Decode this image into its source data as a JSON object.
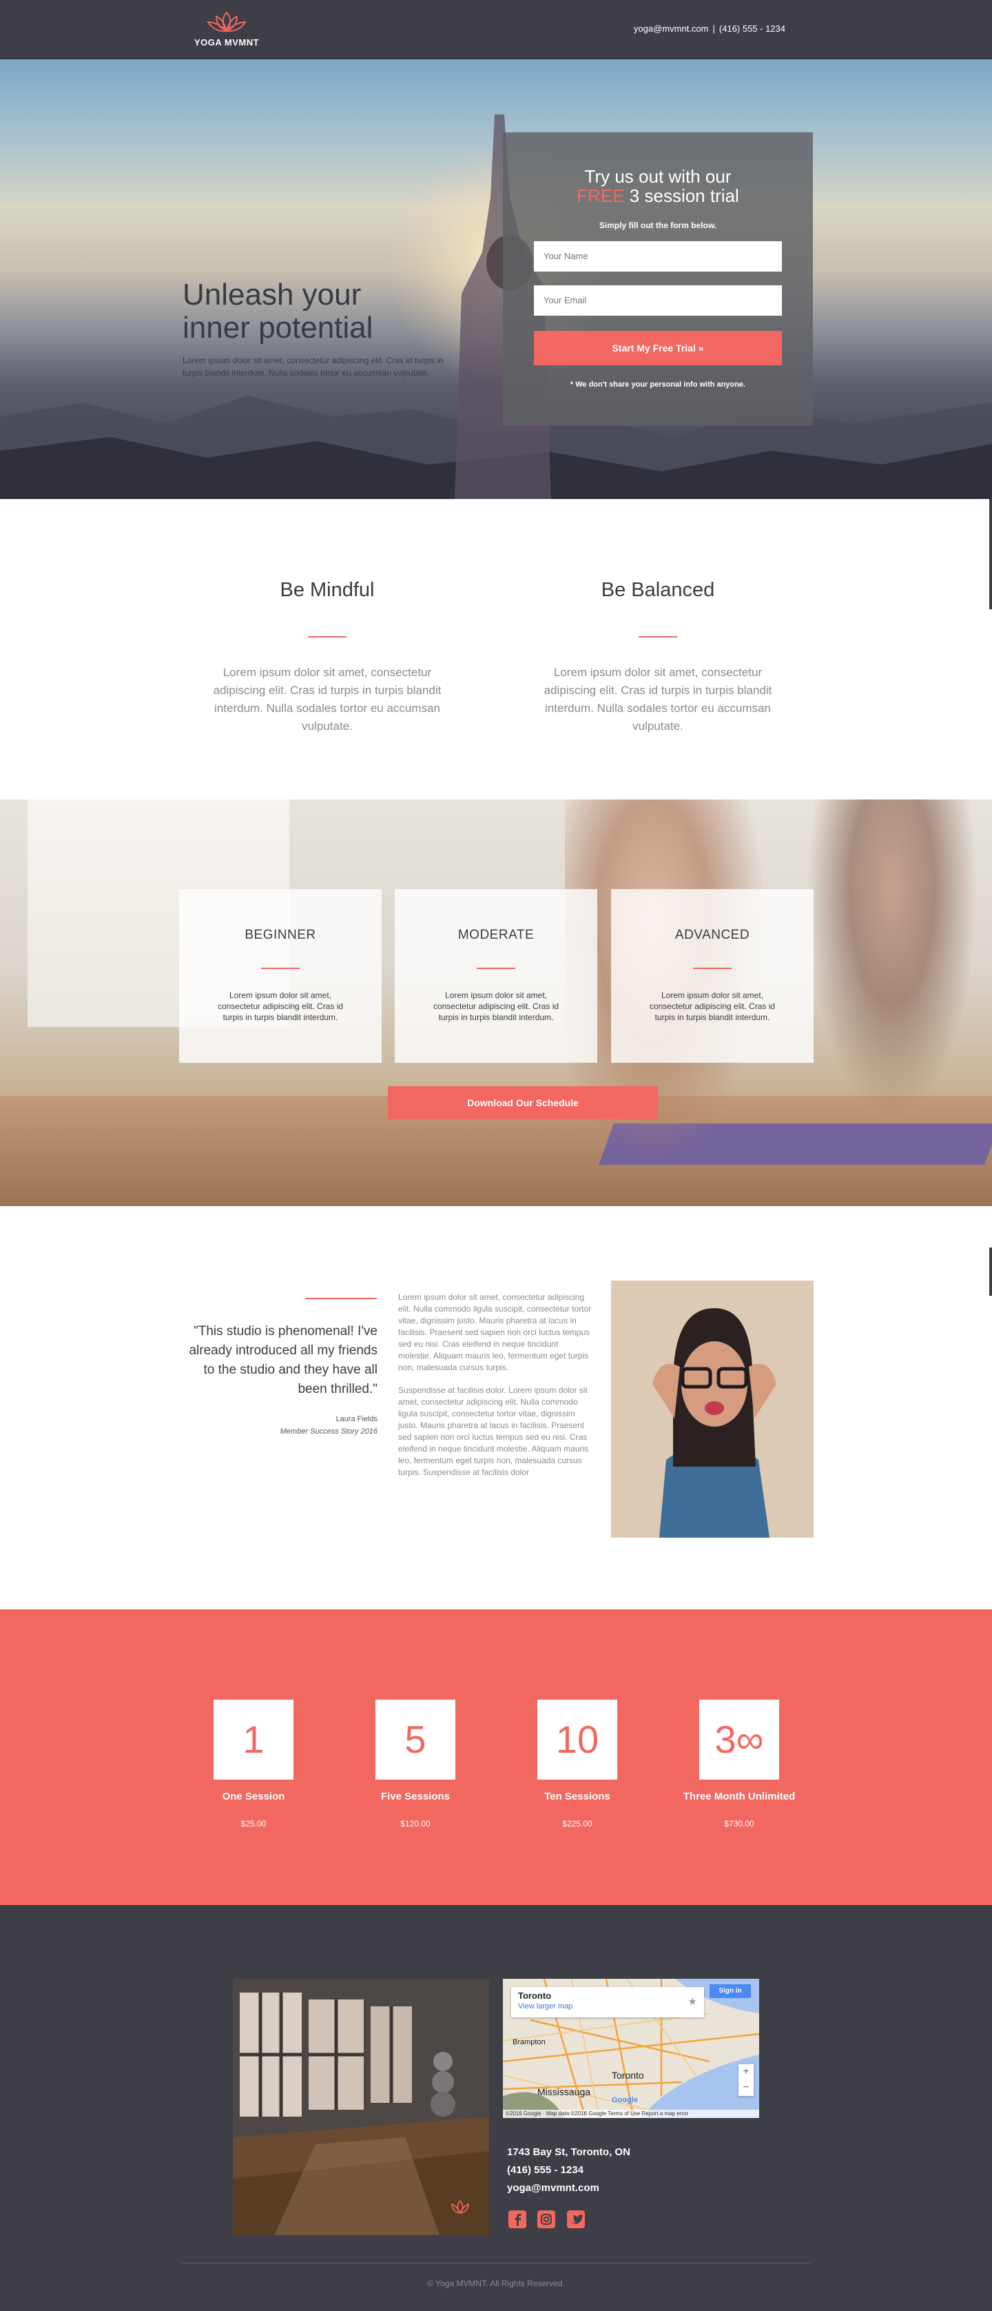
{
  "brand": {
    "name": "YOGA MVMNT",
    "accent": "#f2675f",
    "dark": "#3d3e46"
  },
  "header": {
    "email": "yoga@mvmnt.com",
    "separator": "|",
    "phone": "(416) 555 - 1234"
  },
  "hero": {
    "title_line1": "Unleash your",
    "title_line2": "inner potential",
    "subtitle": "Lorem ipsum dolor sit amet, consectetur adipiscing elit. Cras id turpis in turpis blandit interdum. Nulla sodales tortor eu accumsan vulputate.",
    "form": {
      "heading_line1": "Try us out with our",
      "heading_free": "FREE",
      "heading_rest": "3 session trial",
      "note": "Simply fill out the form below.",
      "name_placeholder": "Your Name",
      "email_placeholder": "Your Email",
      "submit_label": "Start My Free Trial »",
      "disclaimer": "* We don't share your personal info with anyone."
    }
  },
  "features": [
    {
      "title": "Be Mindful",
      "text": "Lorem ipsum dolor sit amet, consectetur adipiscing elit. Cras id turpis in turpis blandit interdum. Nulla sodales tortor eu accumsan vulputate."
    },
    {
      "title": "Be Balanced",
      "text": "Lorem ipsum dolor sit amet, consectetur adipiscing elit. Cras id turpis in turpis blandit interdum. Nulla sodales tortor eu accumsan vulputate."
    }
  ],
  "levels": {
    "cards": [
      {
        "title": "BEGINNER",
        "text": "Lorem ipsum dolor sit amet, consectetur adipiscing elit. Cras id turpis in turpis blandit interdum."
      },
      {
        "title": "MODERATE",
        "text": "Lorem ipsum dolor sit amet, consectetur adipiscing elit. Cras id turpis in turpis blandit interdum."
      },
      {
        "title": "ADVANCED",
        "text": "Lorem ipsum dolor sit amet, consectetur adipiscing elit. Cras id turpis in turpis blandit interdum."
      }
    ],
    "button_label": "Download Our Schedule"
  },
  "testimonial": {
    "quote": "\"This studio is phenomenal! I've already introduced all my friends to the studio and they have all been thrilled.\"",
    "name": "Laura Fields",
    "role": "Member Success Story 2016",
    "paragraph1": "Lorem ipsum dolor sit amet, consectetur adipiscing elit. Nulla commodo ligula suscipit, consectetur tortor vitae, dignissim justo. Mauris pharetra at lacus in facilisis. Praesent sed sapien non orci luctus tempus sed eu nisi. Cras eleifend in neque tincidunt molestie. Aliquam mauris leo, fermentum eget turpis non, malesuada cursus turpis.",
    "paragraph2": "Suspendisse at facilisis dolor. Lorem ipsum dolor sit amet, consectetur adipiscing elit. Nulla commodo ligula suscipit, consectetur tortor vitae, dignissim justo. Mauris pharetra at lacus in facilisis. Praesent sed sapien non orci luctus tempus sed eu nisi. Cras eleifend in neque tincidunt molestie. Aliquam mauris leo, fermentum eget turpis non, malesuada cursus turpis. Suspendisse at facilisis dolor"
  },
  "pricing": [
    {
      "number": "1",
      "name": "One Session",
      "price": "$25.00"
    },
    {
      "number": "5",
      "name": "Five Sessions",
      "price": "$120.00"
    },
    {
      "number": "10",
      "name": "Ten Sessions",
      "price": "$225.00"
    },
    {
      "number": "3∞",
      "name": "Three Month Unlimited",
      "price": "$730.00"
    }
  ],
  "footer": {
    "map": {
      "city": "Toronto",
      "link": "View larger map",
      "signin": "Sign in",
      "labels": [
        "Brampton",
        "Mississauga",
        "Toronto",
        "Google"
      ],
      "attribution": "©2016 Google · Map data ©2016 Google   Terms of Use   Report a map error"
    },
    "address": "1743 Bay St, Toronto, ON",
    "phone": "(416) 555 - 1234",
    "email": "yoga@mvmnt.com",
    "socials": [
      "facebook-icon",
      "instagram-icon",
      "twitter-icon"
    ],
    "copyright": "© Yoga MVMNT. All Rights Reserved."
  }
}
